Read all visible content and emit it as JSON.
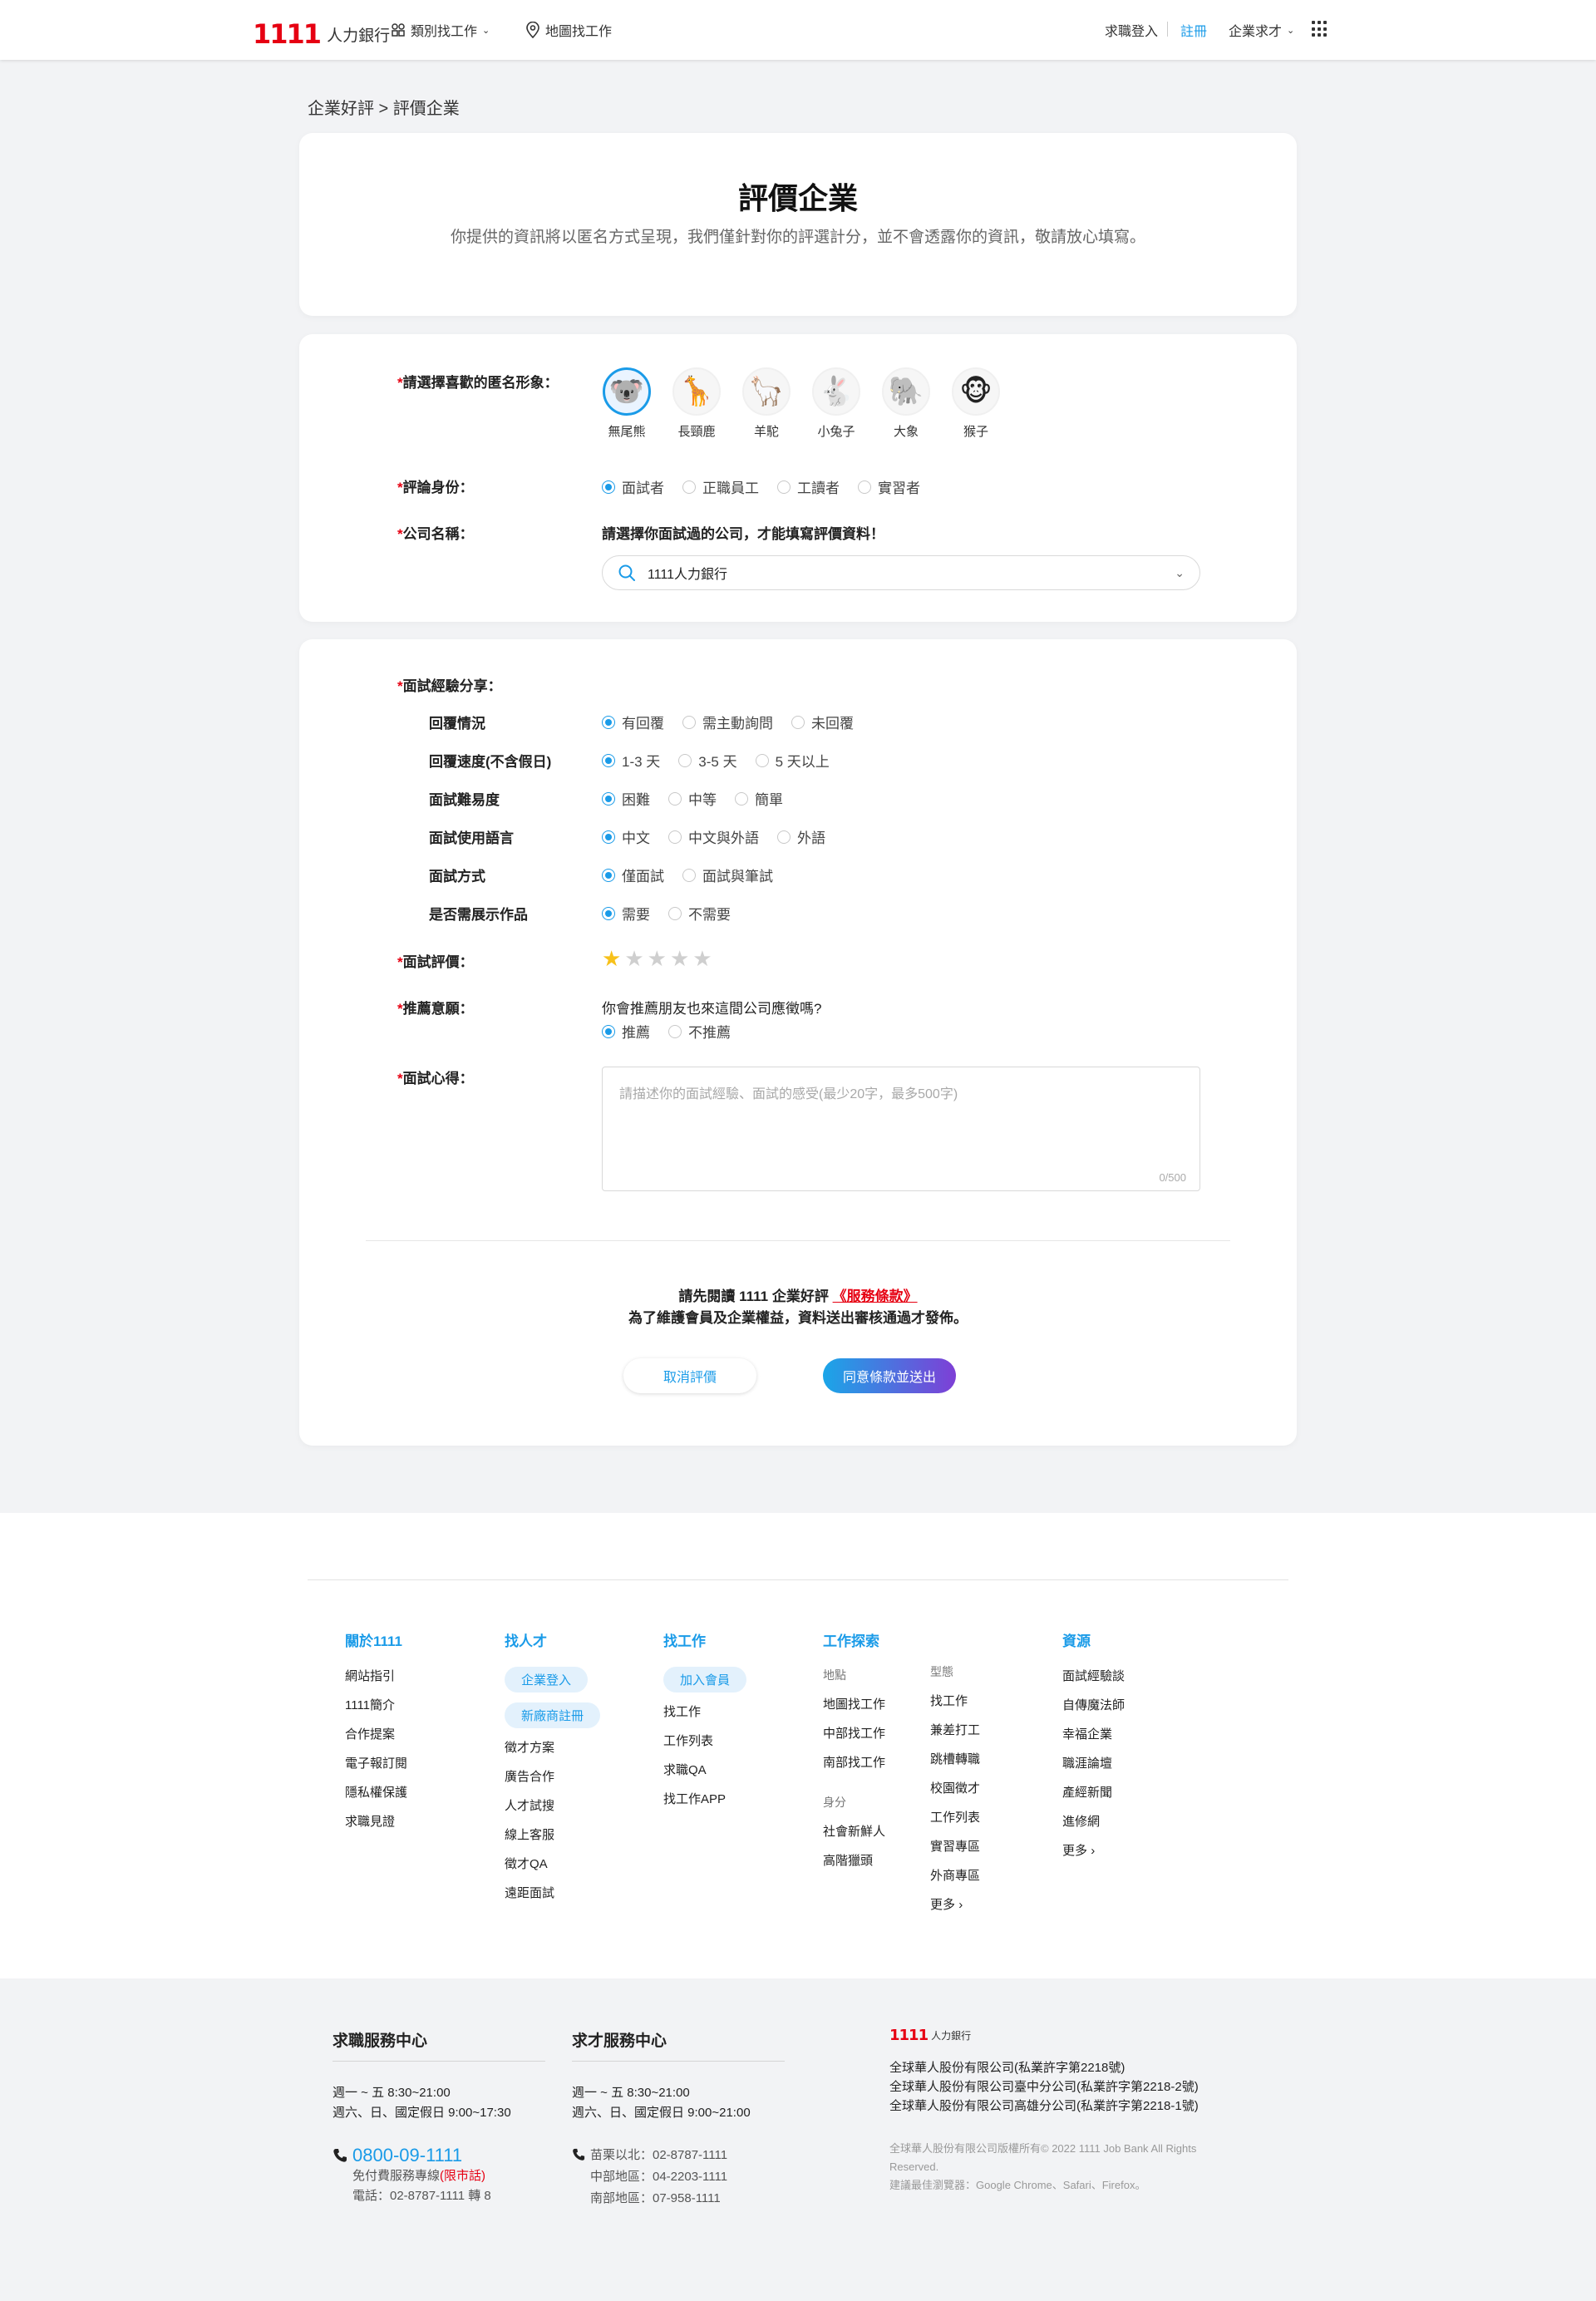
{
  "header": {
    "logo_num": "1111",
    "logo_text": "人力銀行",
    "nav_category": "類別找工作",
    "nav_map": "地圖找工作",
    "login": "求職登入",
    "register": "註冊",
    "employer": "企業求才"
  },
  "breadcrumb": "企業好評 > 評價企業",
  "intro": {
    "title": "評價企業",
    "subtitle": "你提供的資訊將以匿名方式呈現，我們僅針對你的評選計分，並不會透露你的資訊，敬請放心填寫。"
  },
  "identity": {
    "avatar_label": "請選擇喜歡的匿名形象：",
    "avatars": [
      {
        "name": "無尾熊",
        "emoji": "🐨"
      },
      {
        "name": "長頸鹿",
        "emoji": "🦒"
      },
      {
        "name": "羊駝",
        "emoji": "🦙"
      },
      {
        "name": "小兔子",
        "emoji": "🐇"
      },
      {
        "name": "大象",
        "emoji": "🐘"
      },
      {
        "name": "猴子",
        "emoji": "🐵"
      }
    ],
    "role_label": "評論身份：",
    "roles": [
      "面試者",
      "正職員工",
      "工讀者",
      "實習者"
    ],
    "company_label": "公司名稱：",
    "company_hint": "請選擇你面試過的公司，才能填寫評價資料！",
    "company_value": "1111人力銀行"
  },
  "experience": {
    "label": "面試經驗分享：",
    "rows": [
      {
        "label": "回覆情況",
        "options": [
          "有回覆",
          "需主動詢問",
          "未回覆"
        ]
      },
      {
        "label": "回覆速度(不含假日)",
        "options": [
          "1-3 天",
          "3-5 天",
          "5 天以上"
        ]
      },
      {
        "label": "面試難易度",
        "options": [
          "困難",
          "中等",
          "簡單"
        ]
      },
      {
        "label": "面試使用語言",
        "options": [
          "中文",
          "中文與外語",
          "外語"
        ]
      },
      {
        "label": "面試方式",
        "options": [
          "僅面試",
          "面試與筆試"
        ]
      },
      {
        "label": "是否需展示作品",
        "options": [
          "需要",
          "不需要"
        ]
      }
    ],
    "rating_label": "面試評價：",
    "rating": 1,
    "rating_max": 5,
    "recommend_label": "推薦意願：",
    "recommend_question": "你會推薦朋友也來這間公司應徵嗎?",
    "recommend_options": [
      "推薦",
      "不推薦"
    ],
    "notes_label": "面試心得：",
    "notes_placeholder": "請描述你的面試經驗、面試的感受(最少20字，最多500字)",
    "notes_counter": "0/500"
  },
  "terms": {
    "line1_prefix": "請先閱讀 1111 企業好評",
    "link": "《服務條款》",
    "line2": "為了維護會員及企業權益，資料送出審核通過才發佈。",
    "cancel": "取消評價",
    "submit": "同意條款並送出"
  },
  "footer": {
    "about": {
      "title": "關於1111",
      "links": [
        "網站指引",
        "1111簡介",
        "合作提案",
        "電子報訂閱",
        "隱私權保護",
        "求職見證"
      ]
    },
    "talent": {
      "title": "找人才",
      "pills": [
        "企業登入",
        "新廠商註冊"
      ],
      "links": [
        "徵才方案",
        "廣告合作",
        "人才試搜",
        "線上客服",
        "徵才QA",
        "遠距面試"
      ]
    },
    "job": {
      "title": "找工作",
      "pills": [
        "加入會員"
      ],
      "links": [
        "找工作",
        "工作列表",
        "求職QA",
        "找工作APP"
      ]
    },
    "explore": {
      "title": "工作探索",
      "loc_head": "地點",
      "loc_links": [
        "地圖找工作",
        "中部找工作",
        "南部找工作"
      ],
      "id_head": "身分",
      "id_links": [
        "社會新鮮人",
        "高階獵頭"
      ],
      "type_head": "型態",
      "type_links": [
        "找工作",
        "兼差打工",
        "跳槽轉職",
        "校園徵才",
        "工作列表",
        "實習專區",
        "外商專區",
        "更多"
      ]
    },
    "resources": {
      "title": "資源",
      "links": [
        "面試經驗談",
        "自傳魔法師",
        "幸福企業",
        "職涯論壇",
        "產經新聞",
        "進修網",
        "更多"
      ]
    }
  },
  "service": {
    "job_title": "求職服務中心",
    "job_hours1": "週一 ~ 五 8:30~21:00",
    "job_hours2": "週六、日、國定假日 9:00~17:30",
    "job_phone": "0800-09-1111",
    "job_free_prefix": "免付費服務專線",
    "job_free_note": "(限市話)",
    "job_tel": "電話：02-8787-1111 轉 8",
    "emp_title": "求才服務中心",
    "emp_hours1": "週一 ~ 五 8:30~21:00",
    "emp_hours2": "週六、日、國定假日 9:00~21:00",
    "emp_tel1": "苗栗以北：02-8787-1111",
    "emp_tel2": "中部地區：04-2203-1111",
    "emp_tel3": "南部地區：07-958-1111",
    "corp1": "全球華人股份有限公司(私業許字第2218號)",
    "corp2": "全球華人股份有限公司臺中分公司(私業許字第2218-2號)",
    "corp3": "全球華人股份有限公司高雄分公司(私業許字第2218-1號)",
    "copyright": "全球華人股份有限公司版權所有© 2022 1111 Job Bank All Rights Reserved.",
    "browser": "建議最佳瀏覽器：Google Chrome、Safari、Firefox。"
  },
  "colors": {
    "accent": "#1a9be8",
    "brand_red": "#e60012",
    "star": "#f7c11a"
  }
}
